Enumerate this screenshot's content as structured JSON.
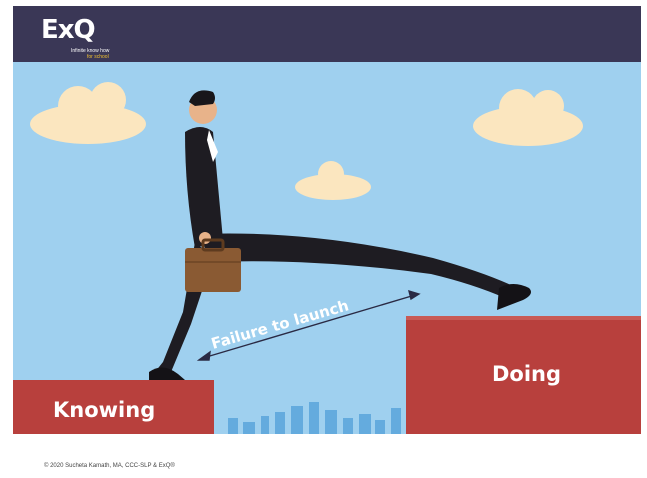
{
  "logo": {
    "mark": "ExQ",
    "tagline_line1": "Infinite know how",
    "tagline_line2": "for school"
  },
  "scene": {
    "left_block_label": "Knowing",
    "right_block_label": "Doing",
    "gap_label": "Failure to launch"
  },
  "footer": {
    "copyright": "© 2020 Sucheta Kamath, MA, CCC-SLP & ExQ®"
  },
  "colors": {
    "header": "#3a3756",
    "sky": "#9fd0ef",
    "block": "#b8403d",
    "cloud": "#fbe6bf"
  }
}
